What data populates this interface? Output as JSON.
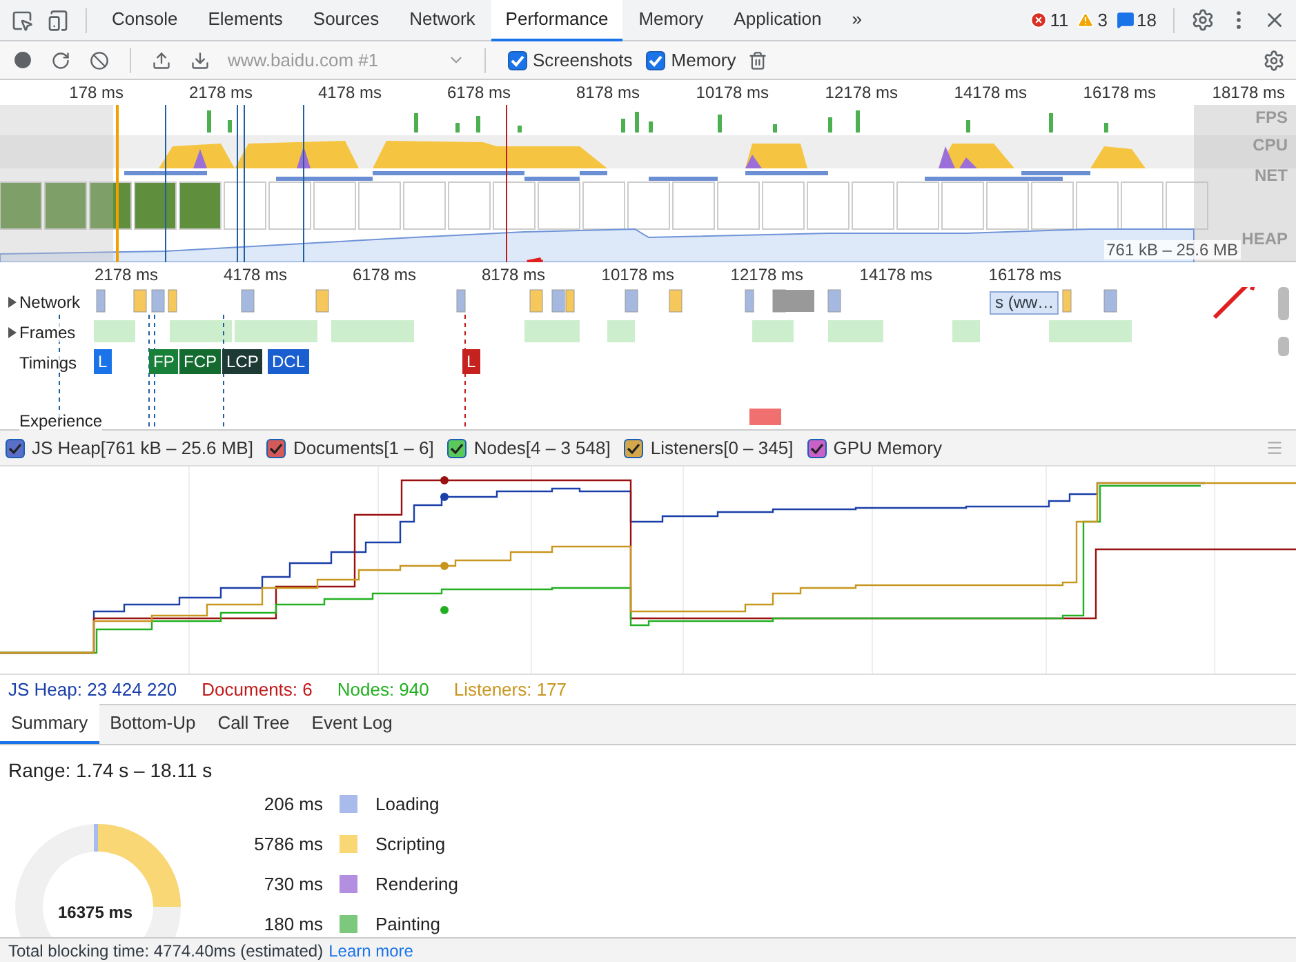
{
  "tabs": [
    {
      "label": "Console",
      "selected": false
    },
    {
      "label": "Elements",
      "selected": false
    },
    {
      "label": "Sources",
      "selected": false
    },
    {
      "label": "Network",
      "selected": false
    },
    {
      "label": "Performance",
      "selected": true
    },
    {
      "label": "Memory",
      "selected": false
    },
    {
      "label": "Application",
      "selected": false
    }
  ],
  "more_tabs": "»",
  "counts": [
    {
      "kind": "error",
      "value": "11"
    },
    {
      "kind": "warning",
      "value": "3"
    },
    {
      "kind": "info",
      "value": "18"
    }
  ],
  "toolbar": {
    "recording": "www.baidu.com #1",
    "checkboxes": [
      {
        "label": "Screenshots",
        "checked": true
      },
      {
        "label": "Memory",
        "checked": true
      }
    ]
  },
  "overview": {
    "ticks": [
      "178 ms",
      "2178 ms",
      "4178 ms",
      "6178 ms",
      "8178 ms",
      "10178 ms",
      "12178 ms",
      "14178 ms",
      "16178 ms",
      "18178 ms"
    ],
    "lanes": [
      "FPS",
      "CPU",
      "NET",
      "HEAP"
    ],
    "heap_range": "761 kB – 25.6 MB"
  },
  "tracks": {
    "ticks": [
      "2178 ms",
      "4178 ms",
      "6178 ms",
      "8178 ms",
      "10178 ms",
      "12178 ms",
      "14178 ms",
      "16178 ms"
    ],
    "rows": [
      {
        "label": "Network",
        "expandable": true
      },
      {
        "label": "Frames",
        "expandable": true
      },
      {
        "label": "Timings",
        "expandable": false
      },
      {
        "label": "Experience",
        "expandable": false
      }
    ],
    "network_request": "s (ww…",
    "markers": [
      {
        "label": "L",
        "color": "#1a73e8"
      },
      {
        "label": "FP",
        "color": "#188038"
      },
      {
        "label": "FCP",
        "color": "#136b30"
      },
      {
        "label": "LCP",
        "color": "#1e3a34"
      },
      {
        "label": "DCL",
        "color": "#1a5fd0"
      },
      {
        "label": "L",
        "color": "#c5221f"
      }
    ]
  },
  "memory_legend": [
    {
      "label": "JS Heap[761 kB – 25.6 MB]",
      "checked": true,
      "color": "#5a6fc8"
    },
    {
      "label": "Documents[1 – 6]",
      "checked": true,
      "color": "#d45a5a"
    },
    {
      "label": "Nodes[4 – 3 548]",
      "checked": true,
      "color": "#5ac85a"
    },
    {
      "label": "Listeners[0 – 345]",
      "checked": true,
      "color": "#d4a84a"
    },
    {
      "label": "GPU Memory",
      "checked": true,
      "color": "#c860c8"
    }
  ],
  "readouts": [
    {
      "label": "JS Heap: 23 424 220",
      "color": "#1a3fa8"
    },
    {
      "label": "Documents: 6",
      "color": "#c01a1a"
    },
    {
      "label": "Nodes: 940",
      "color": "#22b022"
    },
    {
      "label": "Listeners: 177",
      "color": "#c8961e"
    }
  ],
  "bottom_tabs": [
    {
      "label": "Summary",
      "selected": true
    },
    {
      "label": "Bottom-Up",
      "selected": false
    },
    {
      "label": "Call Tree",
      "selected": false
    },
    {
      "label": "Event Log",
      "selected": false
    }
  ],
  "summary": {
    "range": "Range: 1.74 s – 18.11 s",
    "total": "16375 ms",
    "categories": [
      {
        "value": "206 ms",
        "label": "Loading",
        "color": "#a8bbea"
      },
      {
        "value": "5786 ms",
        "label": "Scripting",
        "color": "#f8d774"
      },
      {
        "value": "730 ms",
        "label": "Rendering",
        "color": "#b28fe0"
      },
      {
        "value": "180 ms",
        "label": "Painting",
        "color": "#7cc87c"
      }
    ]
  },
  "footer": {
    "text": "Total blocking time: 4774.40ms (estimated)",
    "link": "Learn more"
  }
}
